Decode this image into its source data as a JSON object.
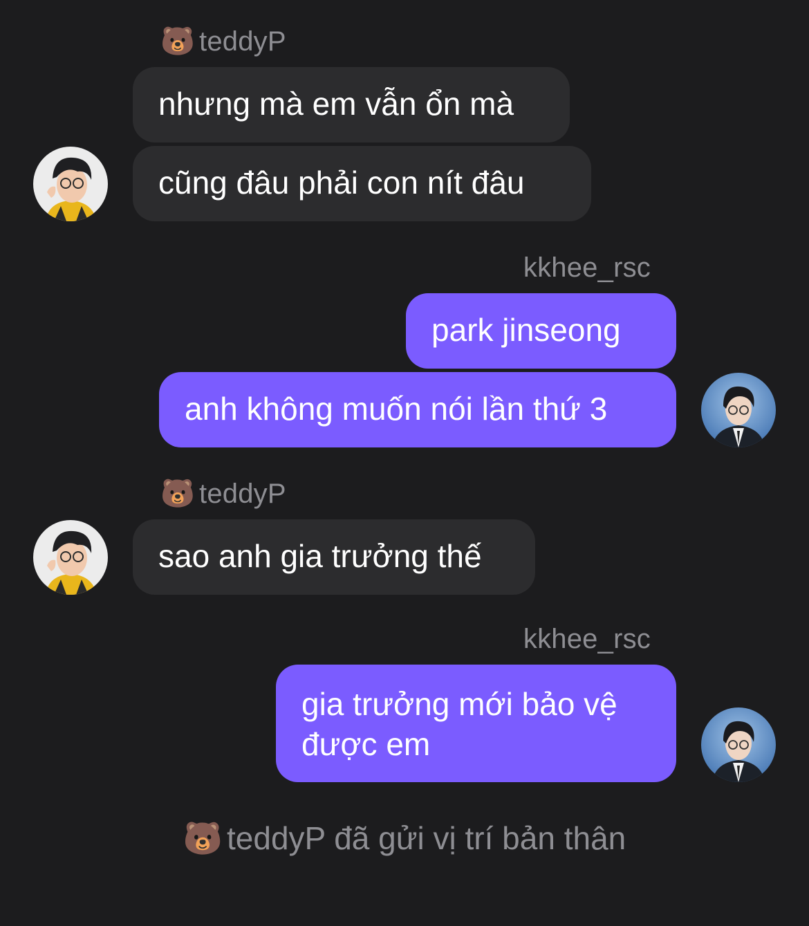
{
  "users": {
    "teddy": {
      "emoji": "🐻",
      "name": "teddyP"
    },
    "kkhee": {
      "name": "kkhee_rsc"
    }
  },
  "messages": [
    {
      "text": "nhưng mà em vẫn ổn mà"
    },
    {
      "text": "cũng đâu phải con nít đâu"
    },
    {
      "text": "park jinseong"
    },
    {
      "text": "anh không muốn nói lần thứ 3"
    },
    {
      "text": "sao anh gia trưởng thế"
    },
    {
      "text": "gia trưởng mới bảo vệ được em"
    }
  ],
  "system": {
    "emoji": "🐻",
    "text": "teddyP đã gửi vị trí bản thân"
  },
  "colors": {
    "background": "#1c1c1e",
    "incoming_bubble": "#2c2c2e",
    "outgoing_bubble": "#7b5cff",
    "meta_text": "#8e8e93"
  }
}
